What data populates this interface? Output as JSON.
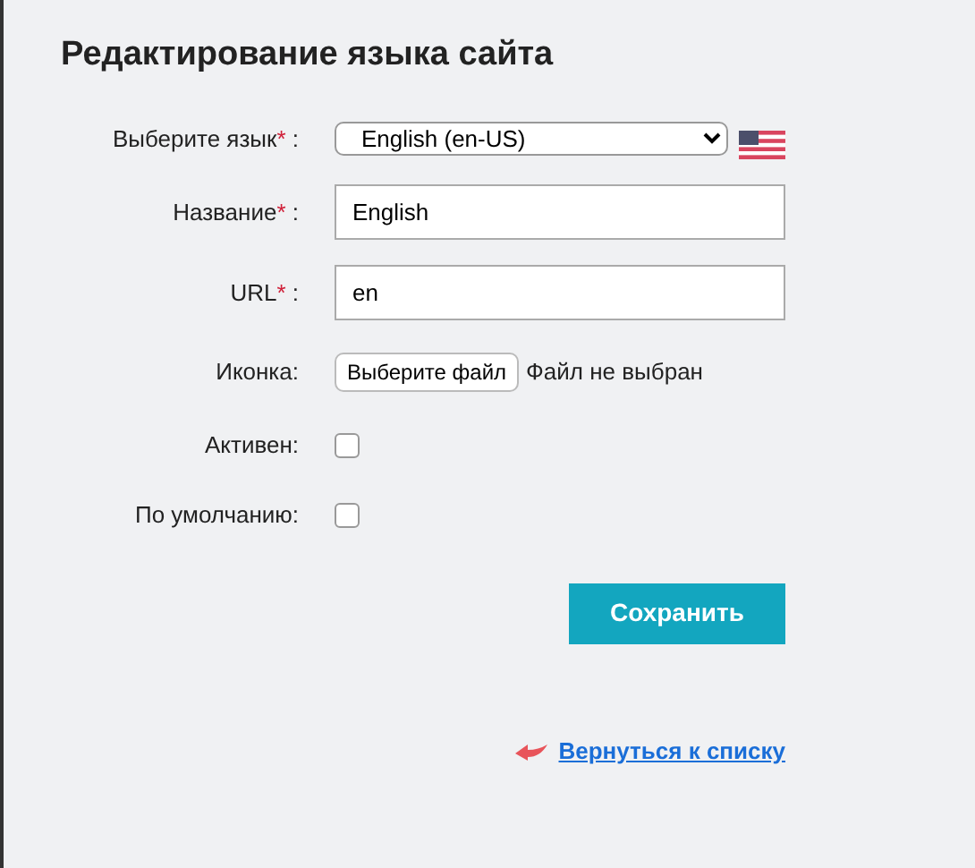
{
  "title": "Редактирование языка сайта",
  "fields": [
    {
      "kind": "select",
      "label": "Выберите язык",
      "required_mark": "*",
      "colon": " :",
      "value": "English (en-US)"
    },
    {
      "kind": "text",
      "label": "Название",
      "required_mark": "*",
      "colon": " :",
      "value": "English"
    },
    {
      "kind": "text",
      "label": "URL",
      "required_mark": "*",
      "colon": " :",
      "value": "en"
    },
    {
      "kind": "file",
      "label": "Иконка:",
      "button": "Выберите файл",
      "status": "Файл не выбран"
    },
    {
      "kind": "checkbox",
      "label": "Активен:",
      "checked": false
    },
    {
      "kind": "checkbox",
      "label": "По умолчанию:",
      "checked": false
    }
  ],
  "save_button": "Сохранить",
  "back_link": "Вернуться к списку"
}
